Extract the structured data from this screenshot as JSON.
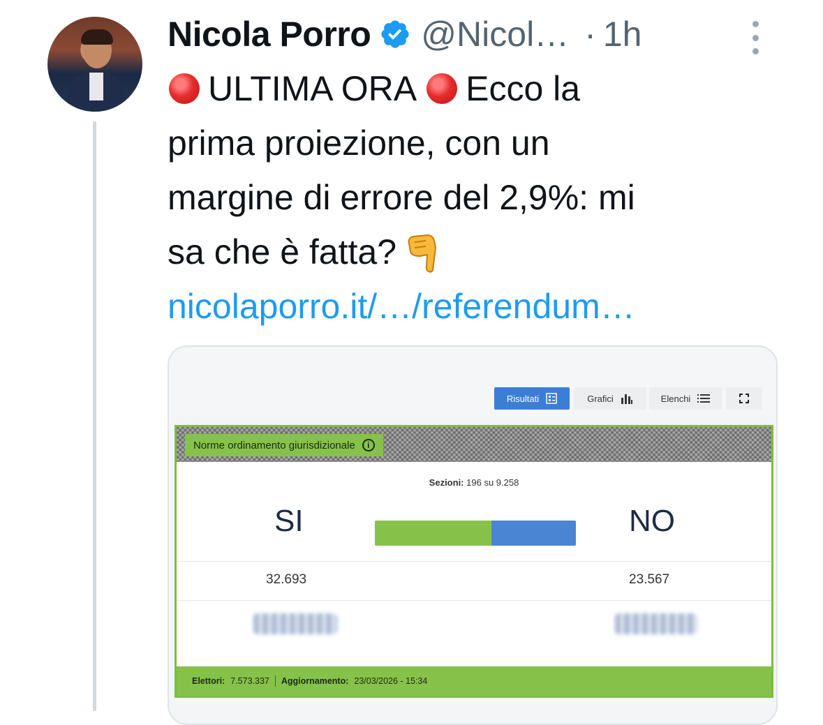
{
  "tweet": {
    "author_name": "Nicola Porro",
    "handle": "@Nicol…",
    "separator": "·",
    "time": "1h",
    "text_lines": [
      {
        "before": "",
        "middle": "ULTIMA ORA",
        "after": "Ecco la"
      },
      "prima proiezione, con un",
      "margine di errore del 2,9%: mi",
      "sa che è fatta?"
    ],
    "link": "nicolaporro.it/…/referendum…",
    "icons": {
      "avatar": "profile-photo",
      "verified": "verified-badge-icon",
      "more": "more-vertical-icon",
      "red_circle": "red-circle-emoji",
      "pointing": "pointing-down-emoji"
    }
  },
  "card": {
    "toolbar": {
      "results": "Risultati",
      "charts": "Grafici",
      "lists": "Elenchi"
    },
    "panel": {
      "title": "Norme ordinamento giurisdizionale",
      "sections_label": "Sezioni:",
      "sections_value": "196 su 9.258",
      "yes_label": "SI",
      "no_label": "NO",
      "yes_votes": "32.693",
      "no_votes": "23.567",
      "yes_fraction": 0.581,
      "footer_voters_label": "Elettori:",
      "footer_voters_value": "7.573.337",
      "footer_update_label": "Aggiornamento:",
      "footer_update_value": "23/03/2026 - 15:34"
    },
    "colors": {
      "accent_green": "#86c24a",
      "accent_blue": "#4a85d4",
      "link_blue": "#1d9bf0"
    }
  }
}
